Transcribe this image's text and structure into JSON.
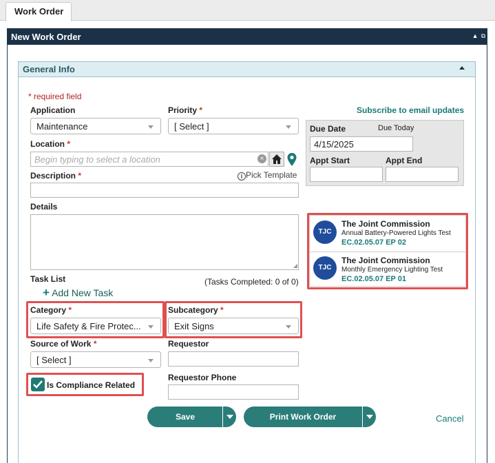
{
  "top_tab": {
    "label": "Work Order"
  },
  "panel": {
    "title": "New Work Order"
  },
  "section": {
    "title": "General Info"
  },
  "required_note": "* required field",
  "subscribe_link": "Subscribe to email updates",
  "fields": {
    "application": {
      "label": "Application",
      "value": "Maintenance"
    },
    "priority": {
      "label": "Priority",
      "value": "[ Select ]"
    },
    "location": {
      "label": "Location",
      "placeholder": "Begin typing to select a location"
    },
    "description": {
      "label": "Description",
      "value": ""
    },
    "pick_template": "Pick Template",
    "details": {
      "label": "Details",
      "value": ""
    },
    "task_list": {
      "label": "Task List",
      "add_task": "Add New Task",
      "completed": "(Tasks Completed: 0 of 0)"
    },
    "category": {
      "label": "Category",
      "value": "Life Safety & Fire Protec..."
    },
    "subcategory": {
      "label": "Subcategory",
      "value": "Exit Signs"
    },
    "source_of_work": {
      "label": "Source of Work",
      "value": "[ Select ]"
    },
    "requestor": {
      "label": "Requestor",
      "value": ""
    },
    "requestor_phone": {
      "label": "Requestor Phone",
      "value": ""
    },
    "compliance": {
      "label": "Is Compliance Related",
      "checked": true
    }
  },
  "dates": {
    "due_date_label": "Due Date",
    "due_today": "Due Today",
    "due_date_value": "4/15/2025",
    "appt_start_label": "Appt Start",
    "appt_end_label": "Appt End"
  },
  "compliance_items": [
    {
      "badge": "TJC",
      "title": "The Joint Commission",
      "subtitle": "Annual Battery-Powered Lights Test",
      "code": "EC.02.05.07 EP 02"
    },
    {
      "badge": "TJC",
      "title": "The Joint Commission",
      "subtitle": "Monthly Emergency Lighting Test",
      "code": "EC.02.05.07 EP 01"
    }
  ],
  "buttons": {
    "save": "Save",
    "print": "Print Work Order",
    "cancel": "Cancel"
  },
  "required_mark": "*",
  "colors": {
    "header": "#1b3147",
    "accent": "#2a7d79",
    "highlight": "#e05050",
    "required": "#c0392b"
  }
}
